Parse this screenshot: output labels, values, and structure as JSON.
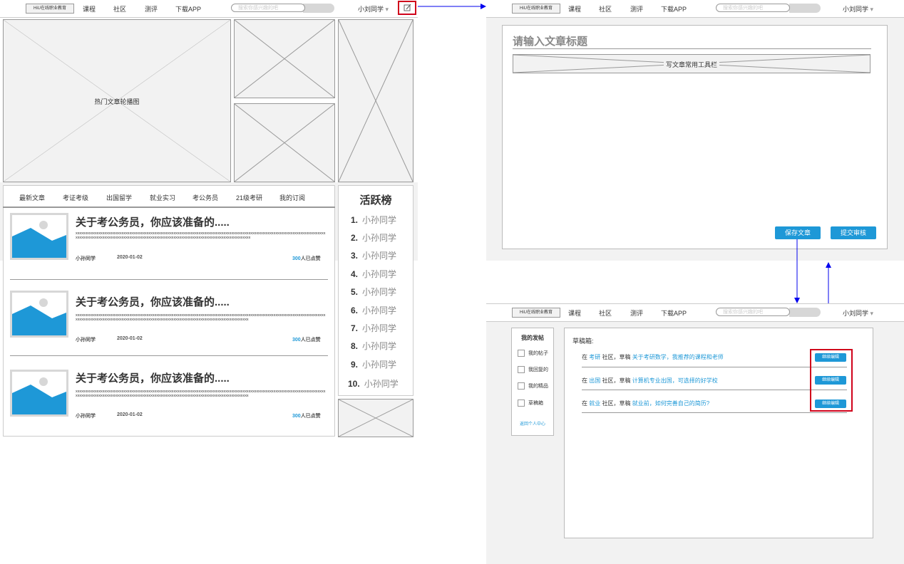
{
  "nav": {
    "logo": "HiU在线职业教育",
    "links": [
      "课程",
      "社区",
      "测评",
      "下载APP"
    ],
    "search_placeholder": "搜索你感兴趣的吧",
    "user": "小刘同学",
    "user_arrow": "▾"
  },
  "home": {
    "carousel_label": "热门文章轮播图",
    "tabs": [
      "最新文章",
      "考证考级",
      "出国留学",
      "就业实习",
      "考公务员",
      "21级考研",
      "我的订阅"
    ],
    "articles": [
      {
        "title": "关于考公务员，你应该准备的.....",
        "excerpt": "xxxxxxxxxxxxxxxxxxxxxxxxxxxxxxxxxxxxxxxxxxxxxxxxxxxxxxxxxxxxxxxxxxxxxxxxxxxxxxxxxxxxxxxxxxxxxxxxxxxxxxxxxxxxxxxxxxxxxxxxxxxxxxxxxxxxxxxxxxxxxxxxxxxxxxxxxxxxxxxxxxxxxxxxxxxxxxxxxxxxxxxxxxxxxxxxxxxxxxxxxxxxxxxxxxxxxxxxxxxxx",
        "author": "小孙同学",
        "date": "2020-01-02",
        "likes": "300",
        "likes_suffix": "人已点赞"
      },
      {
        "title": "关于考公务员，你应该准备的.....",
        "excerpt": "xxxxxxxxxxxxxxxxxxxxxxxxxxxxxxxxxxxxxxxxxxxxxxxxxxxxxxxxxxxxxxxxxxxxxxxxxxxxxxxxxxxxxxxxxxxxxxxxxxxxxxxxxxxxxxxxxxxxxxxxxxxxxxxxxxxxxxxxxxxxxxxxxxxxxxxxxxxxxxxxxxxxxxxxxxxxxxxxxxxxxxxxxxxxxxxxxxxxxxxxxxxxxxxxxxxxxxxxxxxx",
        "author": "小孙同学",
        "date": "2020-01-02",
        "likes": "300",
        "likes_suffix": "人已点赞"
      },
      {
        "title": "关于考公务员，你应该准备的.....",
        "excerpt": "xxxxxxxxxxxxxxxxxxxxxxxxxxxxxxxxxxxxxxxxxxxxxxxxxxxxxxxxxxxxxxxxxxxxxxxxxxxxxxxxxxxxxxxxxxxxxxxxxxxxxxxxxxxxxxxxxxxxxxxxxxxxxxxxxxxxxxxxxxxxxxxxxxxxxxxxxxxxxxxxxxxxxxxxxxxxxxxxxxxxxxxxxxxxxxxxxxxxxxxxxxxxxxxxxxxxxxxxxxxx",
        "author": "小孙同学",
        "date": "2020-01-02",
        "likes": "300",
        "likes_suffix": "人已点赞"
      }
    ],
    "ranking_title": "活跃榜",
    "ranking": [
      {
        "num": "1.",
        "name": "小孙同学"
      },
      {
        "num": "2.",
        "name": "小孙同学"
      },
      {
        "num": "3.",
        "name": "小孙同学"
      },
      {
        "num": "4.",
        "name": "小孙同学"
      },
      {
        "num": "5.",
        "name": "小孙同学"
      },
      {
        "num": "6.",
        "name": "小孙同学"
      },
      {
        "num": "7.",
        "name": "小孙同学"
      },
      {
        "num": "8.",
        "name": "小孙同学"
      },
      {
        "num": "9.",
        "name": "小孙同学"
      },
      {
        "num": "10.",
        "name": "小孙同学"
      }
    ]
  },
  "editor": {
    "title_placeholder": "请输入文章标题",
    "toolbar_label": "写文章常用工具栏",
    "save_button": "保存文章",
    "submit_button": "提交审核"
  },
  "drafts": {
    "sidebar_title": "我的发帖",
    "sidebar_items": [
      "我的帖子",
      "我回复的",
      "我的精品",
      "草稿箱"
    ],
    "back_link": "返回个人中心",
    "header": "草稿箱:",
    "rows": [
      {
        "prefix": "在",
        "community": "考研",
        "middle": "社区，草稿",
        "title": "关于考研数学，我推荐的课程和老师",
        "button": "继续编辑"
      },
      {
        "prefix": "在",
        "community": "出国",
        "middle": "社区，草稿",
        "title": "计算机专业出国，可选择的好学校",
        "button": "继续编辑"
      },
      {
        "prefix": "在",
        "community": "就业",
        "middle": "社区，草稿",
        "title": "就业前，如何完善自己的简历?",
        "button": "继续编辑"
      }
    ]
  },
  "colors": {
    "accent": "#1e98d7",
    "highlight": "#d0021b",
    "flow_arrow": "#0000ee",
    "placeholder_bg": "#f2f2f2"
  }
}
